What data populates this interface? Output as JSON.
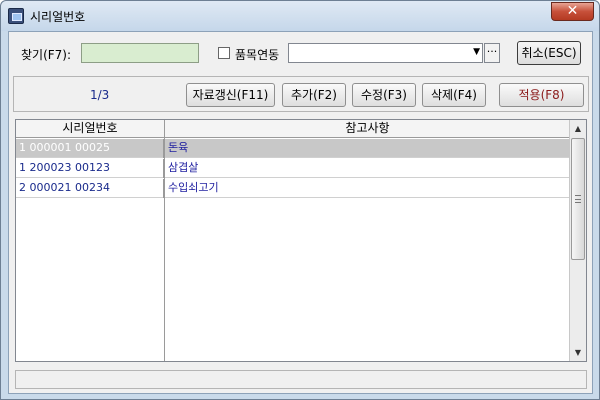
{
  "window": {
    "title": "시리얼번호",
    "close_label": "✕"
  },
  "search": {
    "label": "찾기(F7):",
    "value": "",
    "checkbox_label": "품목연동",
    "checked": false,
    "combo_value": "",
    "more_label": "···",
    "cancel_label": "취소(ESC)"
  },
  "toolbar": {
    "page_counter": "1/3",
    "refresh_label": "자료갱신(F11)",
    "add_label": "추가(F2)",
    "edit_label": "수정(F3)",
    "delete_label": "삭제(F4)",
    "apply_label": "적용(F8)"
  },
  "grid": {
    "columns": [
      "시리얼번호",
      "참고사항"
    ],
    "rows": [
      {
        "serial": "1 000001 00025",
        "note": "돈육",
        "selected": true
      },
      {
        "serial": "1 200023 00123",
        "note": "삼겹살",
        "selected": false
      },
      {
        "serial": "2 000021 00234",
        "note": "수입쇠고기",
        "selected": false
      }
    ]
  },
  "status_bar": {
    "text": ""
  }
}
